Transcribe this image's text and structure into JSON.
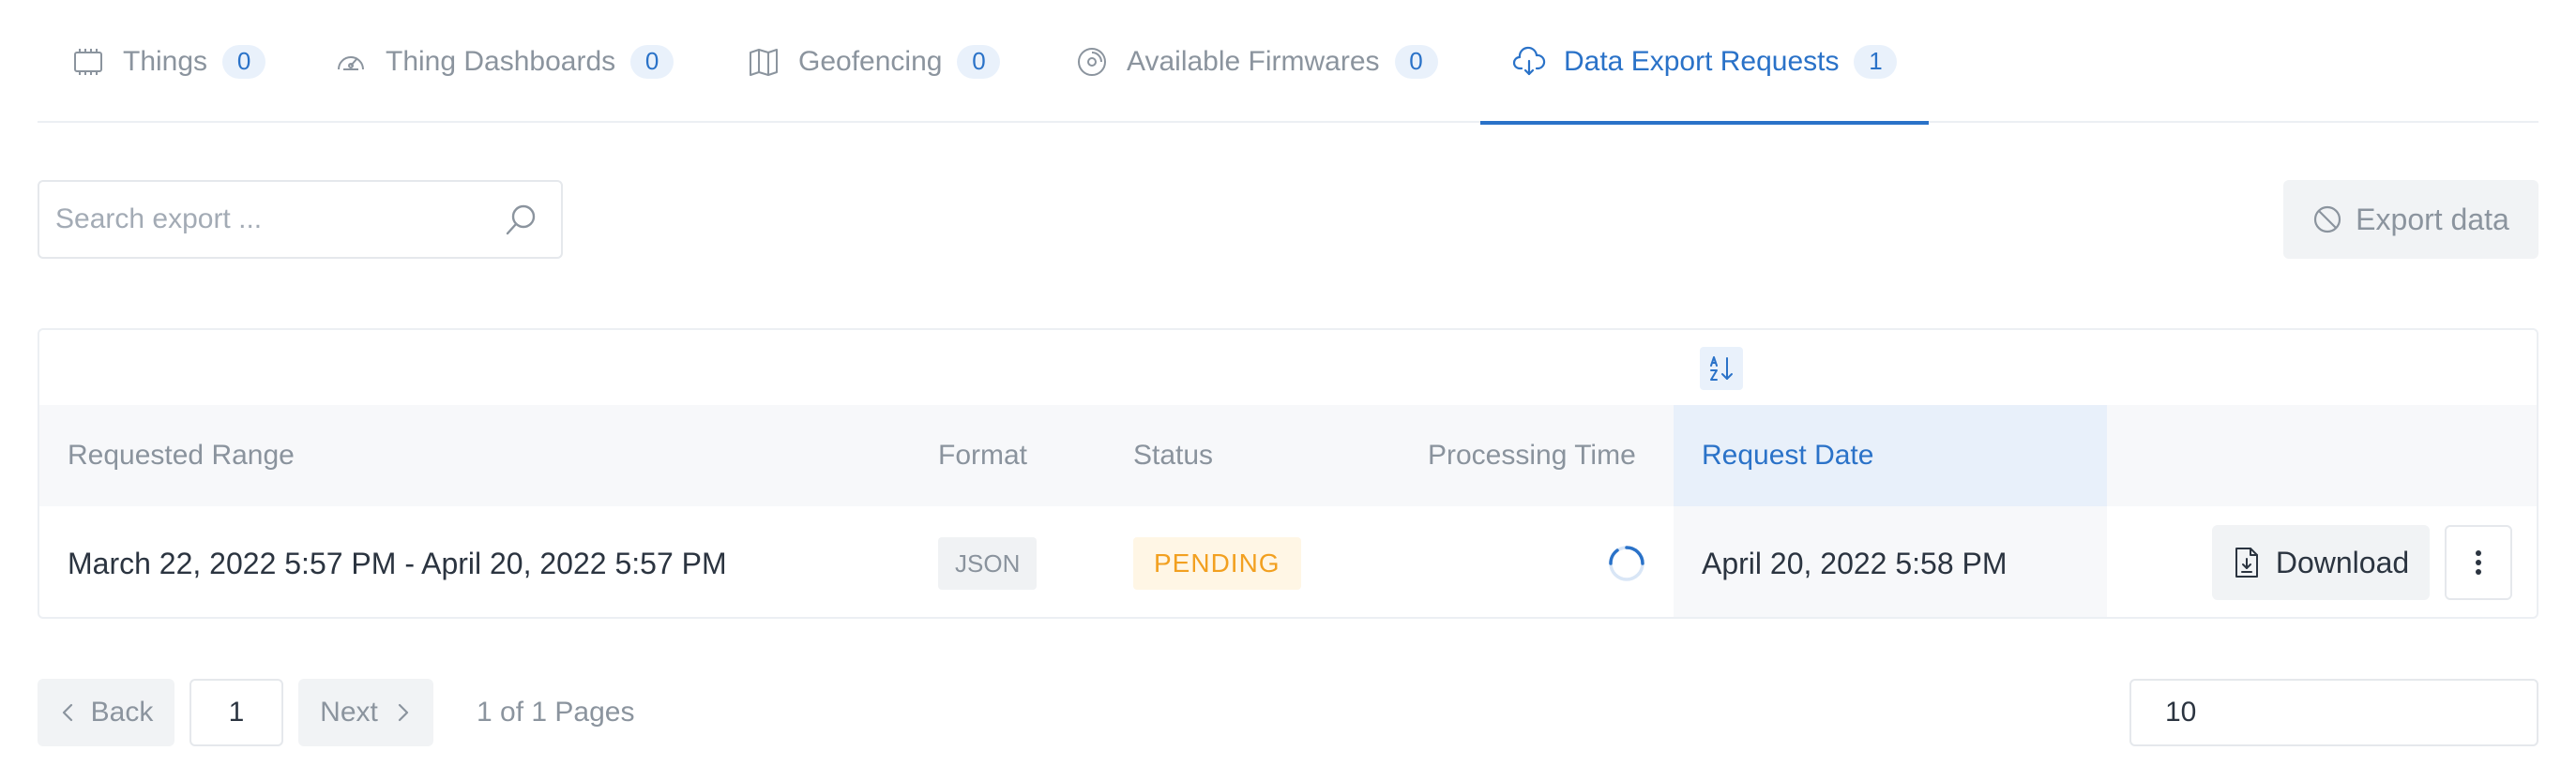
{
  "tabs": [
    {
      "label": "Things",
      "count": "0",
      "icon": "chip-icon"
    },
    {
      "label": "Thing Dashboards",
      "count": "0",
      "icon": "gauge-icon"
    },
    {
      "label": "Geofencing",
      "count": "0",
      "icon": "map-icon"
    },
    {
      "label": "Available Firmwares",
      "count": "0",
      "icon": "disc-icon"
    },
    {
      "label": "Data Export Requests",
      "count": "1",
      "icon": "cloud-download-icon",
      "active": true
    }
  ],
  "search": {
    "placeholder": "Search export ...",
    "value": ""
  },
  "toolbar": {
    "export_label": "Export data",
    "export_disabled": true
  },
  "table": {
    "columns": [
      "Requested Range",
      "Format",
      "Status",
      "Processing Time",
      "Request Date"
    ],
    "sorted_column": "Request Date",
    "rows": [
      {
        "requested_range": "March 22, 2022 5:57 PM - April 20, 2022 5:57 PM",
        "format": "JSON",
        "status": "PENDING",
        "processing_time": "",
        "request_date": "April 20, 2022 5:58 PM",
        "download_label": "Download"
      }
    ]
  },
  "pagination": {
    "back_label": "Back",
    "next_label": "Next",
    "current_page": "1",
    "info": "1 of 1 Pages",
    "page_size": "10"
  },
  "colors": {
    "accent": "#2a72c8",
    "badge_bg": "#e9f1fb",
    "pending": "#f2a020",
    "muted_text": "#8b949e"
  }
}
